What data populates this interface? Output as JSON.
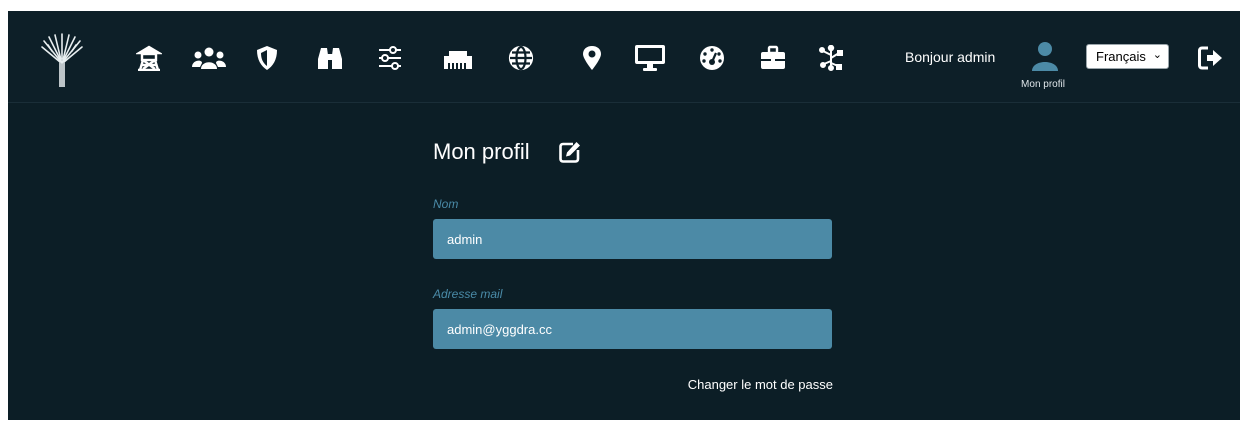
{
  "navbar": {
    "icons": [
      "tree-logo-icon",
      "watchtower-icon",
      "users-icon",
      "shield-icon",
      "binoculars-icon",
      "sliders-icon",
      "ethernet-port-icon",
      "globe-icon",
      "map-marker-icon",
      "monitor-icon",
      "dashboard-gauge-icon",
      "briefcase-icon",
      "network-tree-icon",
      "logout-icon"
    ],
    "greeting": "Bonjour admin",
    "profile_label": "Mon profil",
    "language": "Français",
    "accent_color": "#4c8aa6"
  },
  "main": {
    "title": "Mon profil",
    "fields": [
      {
        "label": "Nom",
        "value": "admin"
      },
      {
        "label": "Adresse mail",
        "value": "admin@yggdra.cc"
      }
    ],
    "change_password": "Changer le mot de passe"
  }
}
